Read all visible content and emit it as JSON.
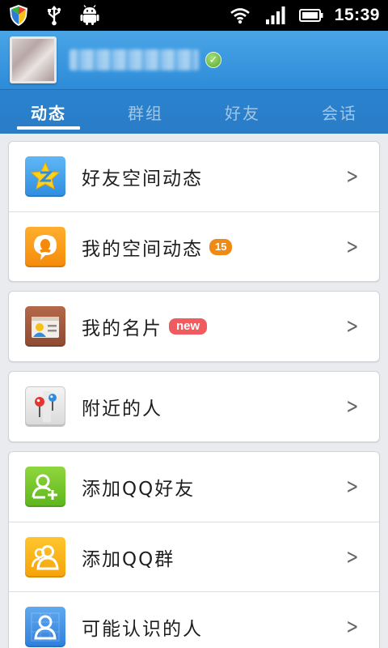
{
  "status_bar": {
    "time": "15:39",
    "icons_left": [
      "shield-icon",
      "usb-icon",
      "android-icon"
    ],
    "icons_right": [
      "wifi-icon",
      "signal-icon",
      "battery-icon"
    ]
  },
  "header": {
    "verified_badge": "✓"
  },
  "tabs": [
    {
      "label": "动态",
      "active": true
    },
    {
      "label": "群组",
      "active": false
    },
    {
      "label": "好友",
      "active": false
    },
    {
      "label": "会话",
      "active": false
    }
  ],
  "cards": [
    [
      {
        "label": "好友空间动态",
        "icon": "qzone-icon",
        "badge": null
      },
      {
        "label": "我的空间动态",
        "icon": "bubble-icon",
        "badge": "15"
      }
    ],
    [
      {
        "label": "我的名片",
        "icon": "card-icon",
        "badge": "new"
      }
    ],
    [
      {
        "label": "附近的人",
        "icon": "map-pin-icon",
        "badge": null
      }
    ],
    [
      {
        "label": "添加QQ好友",
        "icon": "add-friend-icon",
        "badge": null
      },
      {
        "label": "添加QQ群",
        "icon": "add-group-icon",
        "badge": null
      },
      {
        "label": "可能认识的人",
        "icon": "people-icon",
        "badge": null
      }
    ]
  ],
  "colors": {
    "header": "#3a98df",
    "tab_bar": "#2a80ca",
    "badge_count": "#f08a16",
    "badge_new": "#ef5b5f"
  }
}
